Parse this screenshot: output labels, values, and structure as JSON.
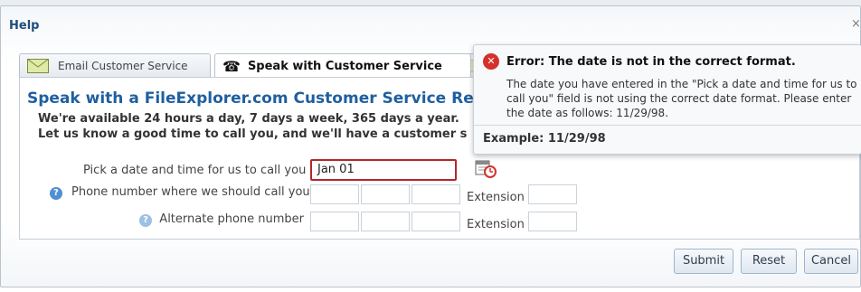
{
  "dialog": {
    "title": "Help"
  },
  "tabs": [
    {
      "label": "Email Customer Service",
      "icon": "envelope-icon"
    },
    {
      "label": "Speak with Customer Service",
      "icon": "telephone-icon"
    },
    {
      "label": "",
      "icon": "tab-icon"
    }
  ],
  "panel": {
    "heading": "Speak with a FileExplorer.com Customer Service Repre",
    "availability": "We're available 24 hours a day, 7 days a week, 365 days a year.",
    "callback_prompt": "Let us know a good time to call you, and we'll have a customer s"
  },
  "form": {
    "date_label": "Pick a date and time for us to call you",
    "date_value": "Jan 01",
    "phone_label": "Phone number where we should call you",
    "alt_phone_label": "Alternate phone number",
    "extension_label": "Extension"
  },
  "error": {
    "title": "Error: The date is not in the correct format.",
    "body": "The date you have entered in the \"Pick a date and time for us to call you\" field is not using the correct date format. Please enter the date as follows: 11/29/98.",
    "example": "Example: 11/29/98"
  },
  "buttons": {
    "submit": "Submit",
    "reset": "Reset",
    "cancel": "Cancel"
  },
  "colors": {
    "heading": "#1f5fa0",
    "error_border": "#b3272a",
    "error_icon": "#d4312b"
  }
}
